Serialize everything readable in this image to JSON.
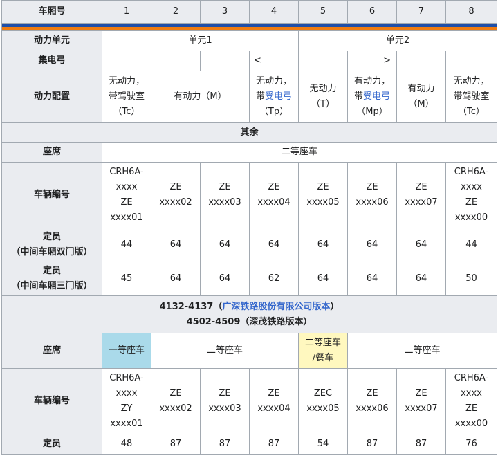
{
  "header": {
    "car_label": "车厢号",
    "cars": [
      "1",
      "2",
      "3",
      "4",
      "5",
      "6",
      "7",
      "8"
    ]
  },
  "stripe_colors": {
    "top": "#1f4fa8",
    "bottom": "#ef7c10"
  },
  "power_unit": {
    "label": "动力单元",
    "unit1": "单元1",
    "unit2": "单元2"
  },
  "pantograph": {
    "label": "集电弓",
    "car4": "<",
    "car6": ">"
  },
  "power_config": {
    "label": "动力配置",
    "car1": "无动力，\n带驾驶室\n（Tc）",
    "car23": "有动力（M）",
    "car4_line1": "无动力，",
    "car4_prefix": "带",
    "car4_link": "受电弓",
    "car4_line3": "（Tp）",
    "car5": "无动力\n（T）",
    "car6_line1": "有动力，",
    "car6_prefix": "带",
    "car6_link": "受电弓",
    "car6_line3": "（Mp）",
    "car7": "有动力\n（M）",
    "car8": "无动力，\n带驾驶室\n（Tc）"
  },
  "section1": {
    "banner": "其余",
    "seat_label": "座席",
    "seat_value": "二等座车",
    "number_label": "车辆编号",
    "numbers": [
      "CRH6A-\nxxxx\nZE\nxxxx01",
      "ZE\nxxxx02",
      "ZE\nxxxx03",
      "ZE\nxxxx04",
      "ZE\nxxxx05",
      "ZE\nxxxx06",
      "ZE\nxxxx07",
      "CRH6A-\nxxxx\nZE\nxxxx00"
    ],
    "capacity_double_label": "定员\n（中间车厢双门版）",
    "capacity_double": [
      "44",
      "64",
      "64",
      "64",
      "64",
      "64",
      "64",
      "44"
    ],
    "capacity_triple_label": "定员\n（中间车厢三门版）",
    "capacity_triple": [
      "45",
      "64",
      "64",
      "62",
      "64",
      "64",
      "64",
      "50"
    ]
  },
  "section2": {
    "banner_line1_prefix": "4132-4137（",
    "banner_line1_link": "广深铁路股份有限公司版本",
    "banner_line1_suffix": "）",
    "banner_line2": "4502-4509（深茂铁路版本）",
    "seat_label": "座席",
    "seat_car1": "一等座车",
    "seat_car234": "二等座车",
    "seat_car5": "二等座车\n/餐车",
    "seat_car678": "二等座车",
    "first_class_color": "#aadaea",
    "dining_color": "#fff8bf",
    "number_label": "车辆编号",
    "numbers": [
      "CRH6A-\nxxxx\nZY\nxxxx01",
      "ZE\nxxxx02",
      "ZE\nxxxx03",
      "ZE\nxxxx04",
      "ZEC\nxxxx05",
      "ZE\nxxxx06",
      "ZE\nxxxx07",
      "CRH6A-\nxxxx\nZE\nxxxx00"
    ],
    "capacity_label": "定员",
    "capacity": [
      "48",
      "87",
      "87",
      "87",
      "54",
      "87",
      "87",
      "76"
    ]
  }
}
